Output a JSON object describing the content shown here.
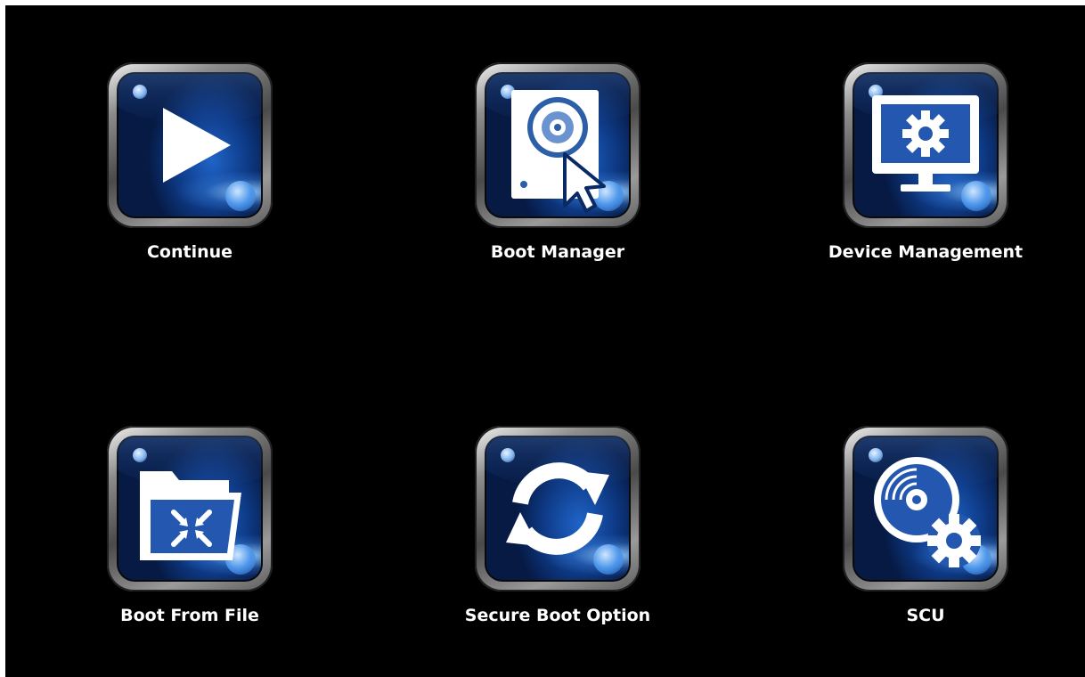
{
  "menu": {
    "items": [
      {
        "id": "continue",
        "label": "Continue",
        "icon": "play-icon"
      },
      {
        "id": "boot-manager",
        "label": "Boot Manager",
        "icon": "disk-pointer-icon"
      },
      {
        "id": "device-management",
        "label": "Device Management",
        "icon": "monitor-gear-icon"
      },
      {
        "id": "boot-from-file",
        "label": "Boot From File",
        "icon": "folder-icon"
      },
      {
        "id": "secure-boot-option",
        "label": "Secure Boot Option",
        "icon": "refresh-icon"
      },
      {
        "id": "scu",
        "label": "SCU",
        "icon": "disc-gear-icon"
      }
    ]
  },
  "colors": {
    "background": "#000000",
    "tile_blue": "#0e3a86",
    "label_text": "#ffffff"
  }
}
